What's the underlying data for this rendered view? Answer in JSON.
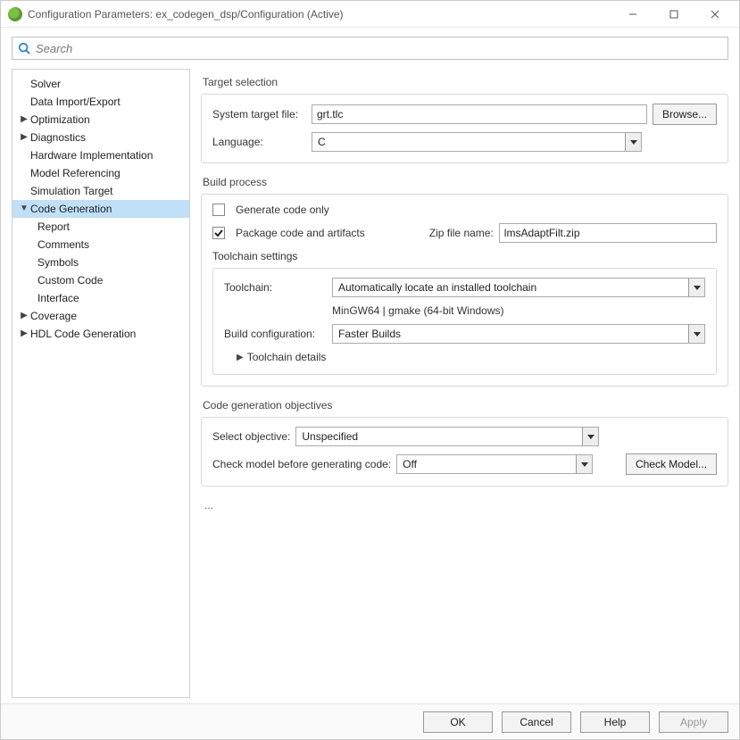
{
  "window": {
    "title": "Configuration Parameters: ex_codegen_dsp/Configuration (Active)"
  },
  "search": {
    "placeholder": "Search"
  },
  "sidebar": {
    "items": [
      {
        "label": "Solver",
        "indent": 1,
        "caret": ""
      },
      {
        "label": "Data Import/Export",
        "indent": 1,
        "caret": ""
      },
      {
        "label": "Optimization",
        "indent": 1,
        "caret": "▶"
      },
      {
        "label": "Diagnostics",
        "indent": 1,
        "caret": "▶"
      },
      {
        "label": "Hardware Implementation",
        "indent": 1,
        "caret": ""
      },
      {
        "label": "Model Referencing",
        "indent": 1,
        "caret": ""
      },
      {
        "label": "Simulation Target",
        "indent": 1,
        "caret": ""
      },
      {
        "label": "Code Generation",
        "indent": 1,
        "caret": "▼",
        "selected": true
      },
      {
        "label": "Report",
        "indent": 2,
        "caret": ""
      },
      {
        "label": "Comments",
        "indent": 2,
        "caret": ""
      },
      {
        "label": "Symbols",
        "indent": 2,
        "caret": ""
      },
      {
        "label": "Custom Code",
        "indent": 2,
        "caret": ""
      },
      {
        "label": "Interface",
        "indent": 2,
        "caret": ""
      },
      {
        "label": "Coverage",
        "indent": 1,
        "caret": "▶"
      },
      {
        "label": "HDL Code Generation",
        "indent": 1,
        "caret": "▶"
      }
    ]
  },
  "target_selection": {
    "title": "Target selection",
    "system_target_file_label": "System target file:",
    "system_target_file_value": "grt.tlc",
    "browse_label": "Browse...",
    "language_label": "Language:",
    "language_value": "C"
  },
  "build_process": {
    "title": "Build process",
    "generate_code_only_label": "Generate code only",
    "generate_code_only_checked": false,
    "package_code_label": "Package code and artifacts",
    "package_code_checked": true,
    "zip_file_label": "Zip file name:",
    "zip_file_value": "lmsAdaptFilt.zip",
    "toolchain_settings_title": "Toolchain settings",
    "toolchain_label": "Toolchain:",
    "toolchain_value": "Automatically locate an installed toolchain",
    "toolchain_info": "MinGW64 | gmake (64-bit Windows)",
    "build_config_label": "Build configuration:",
    "build_config_value": "Faster Builds",
    "toolchain_details_label": "Toolchain details"
  },
  "code_gen_objectives": {
    "title": "Code generation objectives",
    "select_objective_label": "Select objective:",
    "select_objective_value": "Unspecified",
    "check_model_label": "Check model before generating code:",
    "check_model_value": "Off",
    "check_model_button": "Check Model..."
  },
  "ellipsis": "...",
  "footer": {
    "ok": "OK",
    "cancel": "Cancel",
    "help": "Help",
    "apply": "Apply"
  }
}
